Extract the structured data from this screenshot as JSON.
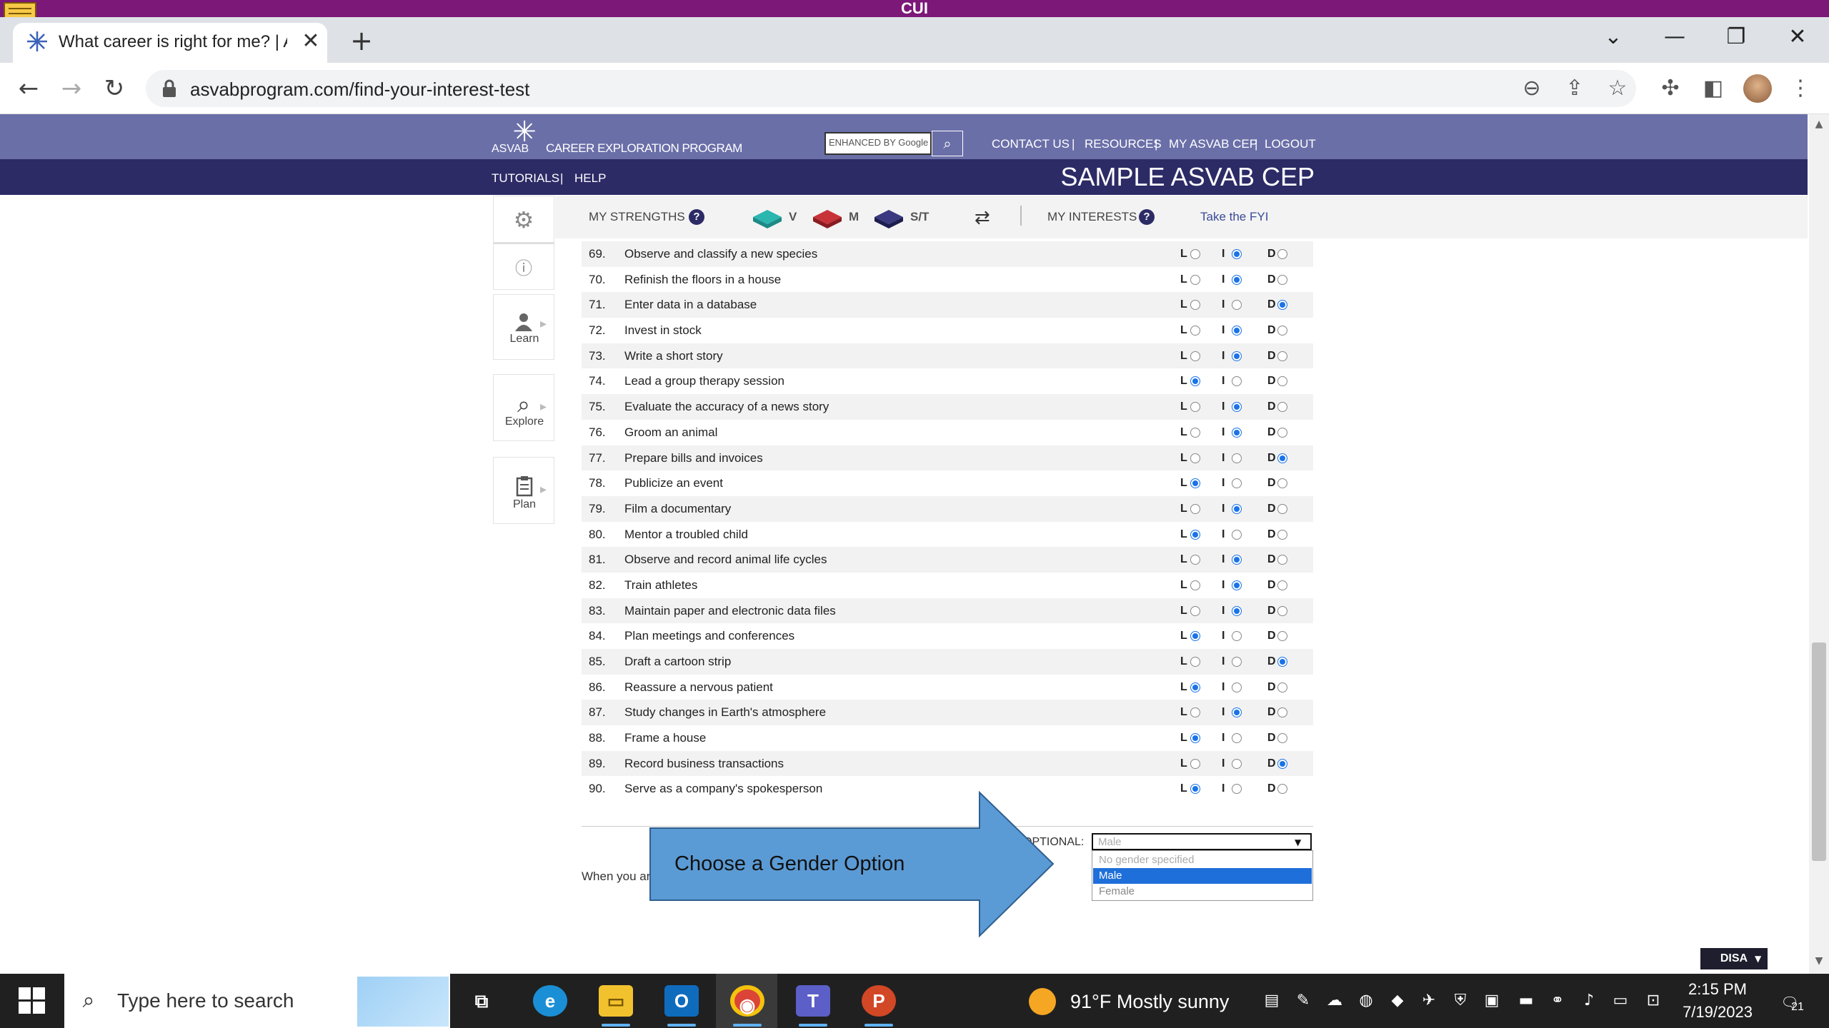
{
  "banner": {
    "text": "CUI"
  },
  "browser": {
    "tab_title": "What career is right for me? | ASVAB",
    "tab_close": "✕",
    "new_tab": "+",
    "url": "asvabprogram.com/find-your-interest-test",
    "window": {
      "dropdown": "⌄",
      "minimize": "—",
      "restore": "❐",
      "close": "✕"
    }
  },
  "site": {
    "logo_asvab": "ASVAB",
    "logo_text": "CAREER EXPLORATION PROGRAM",
    "search_placeholder": "ENHANCED BY Google",
    "top_links": [
      "CONTACT US",
      "|",
      "RESOURCES",
      "|",
      "MY ASVAB CEP",
      "|",
      "LOGOUT"
    ],
    "sub_links": [
      "TUTORIALS",
      "|",
      "HELP"
    ],
    "sample_title": "SAMPLE ASVAB CEP"
  },
  "rail": {
    "items": [
      {
        "icon": "gear-icon",
        "label": ""
      },
      {
        "icon": "help-icon",
        "label": ""
      },
      {
        "icon": "learn-icon",
        "label": "Learn"
      },
      {
        "icon": "explore-icon",
        "label": "Explore"
      },
      {
        "icon": "plan-icon",
        "label": "Plan"
      }
    ]
  },
  "strengths": {
    "my_strengths": "MY STRENGTHS",
    "help": "?",
    "v": "V",
    "m": "M",
    "st": "S/T",
    "my_interests": "MY INTERESTS",
    "take_fyi": "Take the FYI",
    "colors": {
      "v": "#2bb6b0",
      "m": "#b4272d",
      "st": "#2c2b66"
    }
  },
  "option_labels": {
    "l": "L",
    "i": "I",
    "d": "D"
  },
  "questions": [
    {
      "num": "69.",
      "text": "Observe and classify a new species",
      "answer": "I"
    },
    {
      "num": "70.",
      "text": "Refinish the floors in a house",
      "answer": "I"
    },
    {
      "num": "71.",
      "text": "Enter data in a database",
      "answer": "D"
    },
    {
      "num": "72.",
      "text": "Invest in stock",
      "answer": "I"
    },
    {
      "num": "73.",
      "text": "Write a short story",
      "answer": "I"
    },
    {
      "num": "74.",
      "text": "Lead a group therapy session",
      "answer": "L"
    },
    {
      "num": "75.",
      "text": "Evaluate the accuracy of a news story",
      "answer": "I"
    },
    {
      "num": "76.",
      "text": "Groom an animal",
      "answer": "I"
    },
    {
      "num": "77.",
      "text": "Prepare bills and invoices",
      "answer": "D"
    },
    {
      "num": "78.",
      "text": "Publicize an event",
      "answer": "L"
    },
    {
      "num": "79.",
      "text": "Film a documentary",
      "answer": "I"
    },
    {
      "num": "80.",
      "text": "Mentor a troubled child",
      "answer": "L"
    },
    {
      "num": "81.",
      "text": "Observe and record animal life cycles",
      "answer": "I"
    },
    {
      "num": "82.",
      "text": "Train athletes",
      "answer": "I"
    },
    {
      "num": "83.",
      "text": "Maintain paper and electronic data files",
      "answer": "I"
    },
    {
      "num": "84.",
      "text": "Plan meetings and conferences",
      "answer": "L"
    },
    {
      "num": "85.",
      "text": "Draft a cartoon strip",
      "answer": "D"
    },
    {
      "num": "86.",
      "text": "Reassure a nervous patient",
      "answer": "L"
    },
    {
      "num": "87.",
      "text": "Study changes in Earth's atmosphere",
      "answer": "I"
    },
    {
      "num": "88.",
      "text": "Frame a house",
      "answer": "L"
    },
    {
      "num": "89.",
      "text": "Record business transactions",
      "answer": "D"
    },
    {
      "num": "90.",
      "text": "Serve as a company's spokesperson",
      "answer": "L"
    }
  ],
  "footer": {
    "when_text": "When you ar",
    "optional_label": "OPTIONAL:",
    "gender_selected": "Male",
    "gender_options": [
      "No gender specified",
      "Male",
      "Female"
    ],
    "gender_highlighted": "Male"
  },
  "callout": {
    "text": "Choose a Gender Option",
    "color": "#5b9bd5"
  },
  "disa": "DISA",
  "taskbar": {
    "search_placeholder": "Type here to search",
    "weather": "91°F  Mostly sunny",
    "time": "2:15 PM",
    "date": "7/19/2023",
    "notifications": "21",
    "apps": [
      {
        "name": "task-view",
        "color": "#202020",
        "glyph": "⧉"
      },
      {
        "name": "edge",
        "color": "#1a8fd6",
        "glyph": "e"
      },
      {
        "name": "file-explorer",
        "color": "#f2c12e",
        "glyph": "▭"
      },
      {
        "name": "outlook",
        "color": "#0f6cbd",
        "glyph": "O"
      },
      {
        "name": "chrome",
        "color": "#db4437",
        "glyph": "◉"
      },
      {
        "name": "teams",
        "color": "#5b5fc7",
        "glyph": "T"
      },
      {
        "name": "powerpoint",
        "color": "#d24726",
        "glyph": "P"
      }
    ]
  }
}
